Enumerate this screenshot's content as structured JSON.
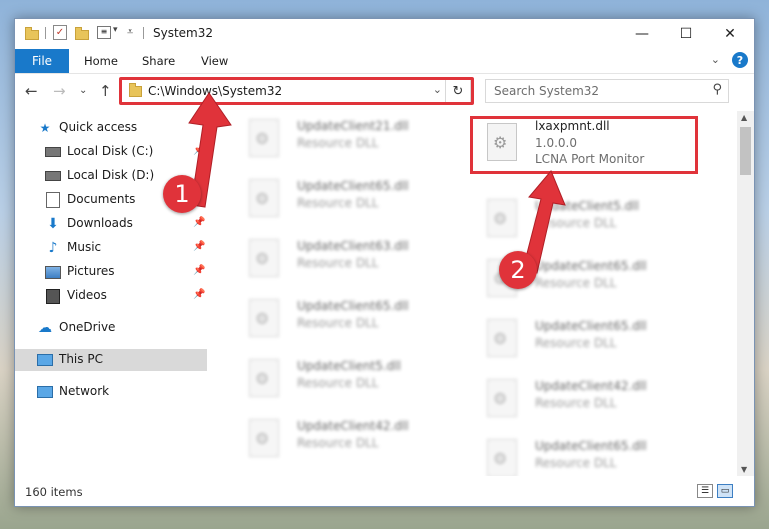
{
  "window": {
    "title": "System32",
    "controls": {
      "minimize": "—",
      "maximize": "☐",
      "close": "✕"
    }
  },
  "ribbon": {
    "tabs": [
      "File",
      "Home",
      "Share",
      "View"
    ],
    "help": "?"
  },
  "navigation": {
    "address": "C:\\Windows\\System32",
    "search_placeholder": "Search System32"
  },
  "sidebar": {
    "items": [
      {
        "label": "Quick access",
        "icon": "star-icon",
        "pinned": false
      },
      {
        "label": "Local Disk (C:)",
        "icon": "drive-icon",
        "pinned": true
      },
      {
        "label": "Local Disk (D:)",
        "icon": "drive-icon",
        "pinned": true
      },
      {
        "label": "Documents",
        "icon": "documents-icon",
        "pinned": true
      },
      {
        "label": "Downloads",
        "icon": "download-icon",
        "pinned": true
      },
      {
        "label": "Music",
        "icon": "music-icon",
        "pinned": true
      },
      {
        "label": "Pictures",
        "icon": "pictures-icon",
        "pinned": true
      },
      {
        "label": "Videos",
        "icon": "video-icon",
        "pinned": true
      },
      {
        "label": "OneDrive",
        "icon": "cloud-icon",
        "pinned": false
      },
      {
        "label": "This PC",
        "icon": "computer-icon",
        "pinned": false,
        "selected": true
      },
      {
        "label": "Network",
        "icon": "network-icon",
        "pinned": false
      }
    ]
  },
  "files": {
    "target": {
      "name": "lxaxpmnt.dll",
      "version": "1.0.0.0",
      "description": "LCNA Port Monitor"
    },
    "left_column": [
      {
        "name": "UpdateClient21.dll",
        "type": "Resource DLL"
      },
      {
        "name": "UpdateClient65.dll",
        "type": "Resource DLL"
      },
      {
        "name": "UpdateClient63.dll",
        "type": "Resource DLL"
      },
      {
        "name": "UpdateClient65.dll",
        "type": "Resource DLL"
      },
      {
        "name": "UpdateClient5.dll",
        "type": "Resource DLL"
      },
      {
        "name": "UpdateClient42.dll",
        "type": "Resource DLL"
      }
    ],
    "right_column": [
      {
        "name": "UpdateClient5.dll",
        "type": "Resource DLL"
      },
      {
        "name": "UpdateClient65.dll",
        "type": "Resource DLL"
      },
      {
        "name": "UpdateClient65.dll",
        "type": "Resource DLL"
      },
      {
        "name": "UpdateClient42.dll",
        "type": "Resource DLL"
      },
      {
        "name": "UpdateClient65.dll",
        "type": "Resource DLL"
      }
    ]
  },
  "status": {
    "item_count": "160 items"
  },
  "callouts": {
    "step1": "1",
    "step2": "2"
  },
  "colors": {
    "accent": "#1979ca",
    "highlight": "#e0333a",
    "selection": "#d9d9d9"
  }
}
